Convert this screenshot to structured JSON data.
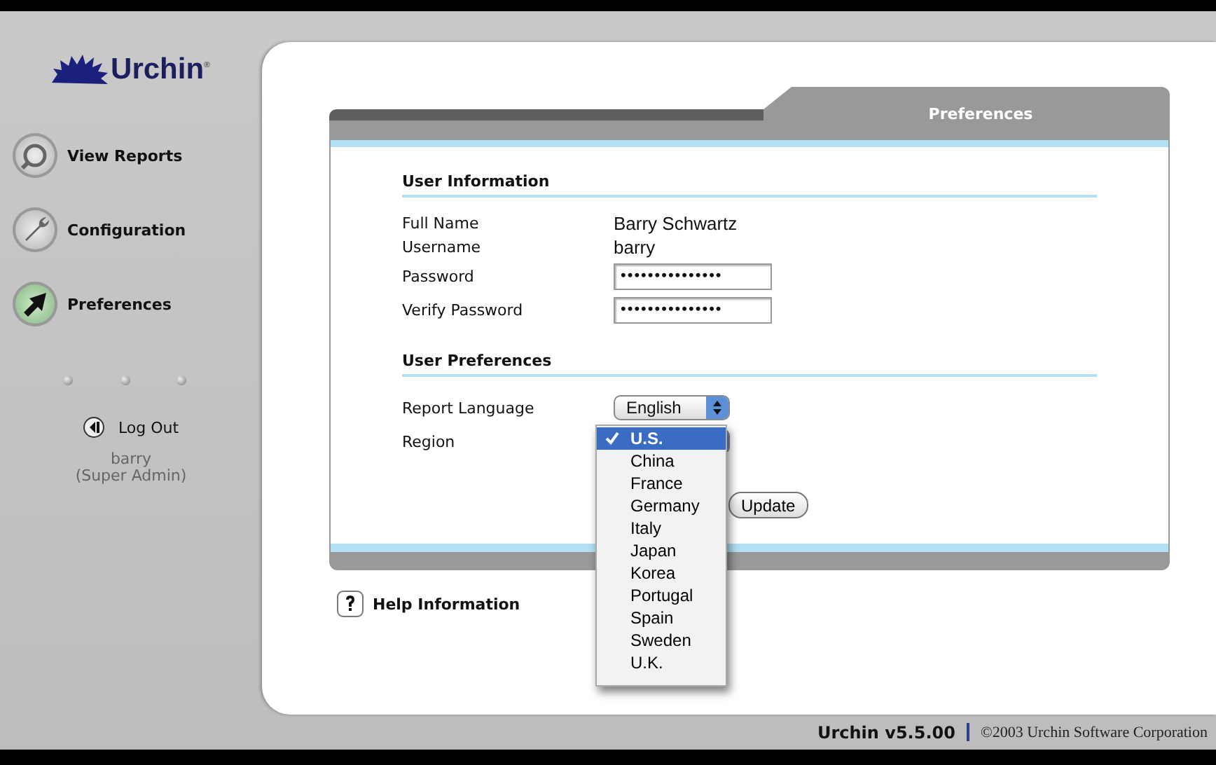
{
  "logo": {
    "name": "Urchin",
    "mark": "®"
  },
  "nav": [
    {
      "label": "View Reports",
      "selected": false
    },
    {
      "label": "Configuration",
      "selected": false
    },
    {
      "label": "Preferences",
      "selected": true
    }
  ],
  "logout": {
    "label": "Log Out"
  },
  "user": {
    "name": "barry",
    "role": "(Super Admin)"
  },
  "panel": {
    "tab": "Preferences",
    "sections": [
      {
        "title": "User Information",
        "fields": [
          {
            "kind": "text",
            "label": "Full Name",
            "value": "Barry Schwartz"
          },
          {
            "kind": "text",
            "label": "Username",
            "value": "barry"
          },
          {
            "kind": "password",
            "label": "Password",
            "value": "•••••••••••••••"
          },
          {
            "kind": "password",
            "label": "Verify Password",
            "value": "•••••••••••••••"
          }
        ]
      },
      {
        "title": "User Preferences",
        "fields": [
          {
            "kind": "select",
            "label": "Report Language",
            "value": "English"
          },
          {
            "kind": "select",
            "label": "Region",
            "open": true,
            "options": [
              {
                "label": "U.S.",
                "selected": true
              },
              {
                "label": "China",
                "selected": false
              },
              {
                "label": "France",
                "selected": false
              },
              {
                "label": "Germany",
                "selected": false
              },
              {
                "label": "Italy",
                "selected": false
              },
              {
                "label": "Japan",
                "selected": false
              },
              {
                "label": "Korea",
                "selected": false
              },
              {
                "label": "Portugal",
                "selected": false
              },
              {
                "label": "Spain",
                "selected": false
              },
              {
                "label": "Sweden",
                "selected": false
              },
              {
                "label": "U.K.",
                "selected": false
              }
            ]
          }
        ]
      }
    ],
    "update_button": "Update"
  },
  "help": {
    "label": "Help Information"
  },
  "footer": {
    "version": "Urchin v5.5.00",
    "copyright": "©2003 Urchin Software Corporation"
  }
}
